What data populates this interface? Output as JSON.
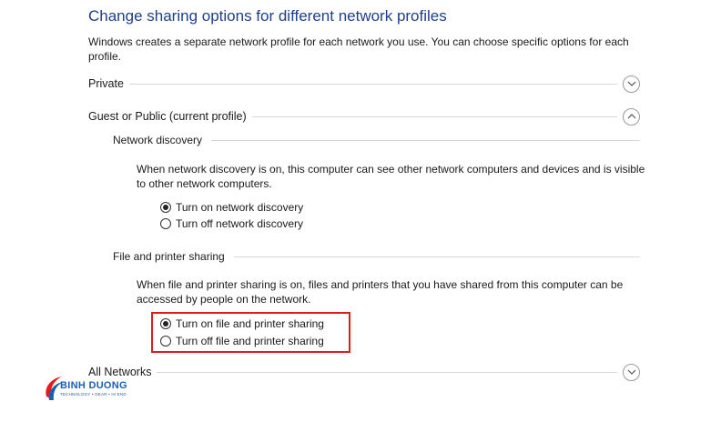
{
  "page": {
    "title": "Change sharing options for different network profiles",
    "description": "Windows creates a separate network profile for each network you use. You can choose specific options for each profile."
  },
  "sections": {
    "private": {
      "label": "Private",
      "expanded": false
    },
    "guest_public": {
      "label": "Guest or Public (current profile)",
      "expanded": true
    },
    "all_networks": {
      "label": "All Networks",
      "expanded": false
    }
  },
  "network_discovery": {
    "heading": "Network discovery",
    "description": "When network discovery is on, this computer can see other network computers and devices and is visible to other network computers.",
    "options": [
      {
        "label": "Turn on network discovery",
        "selected": true
      },
      {
        "label": "Turn off network discovery",
        "selected": false
      }
    ]
  },
  "file_printer_sharing": {
    "heading": "File and printer sharing",
    "description": "When file and printer sharing is on, files and printers that you have shared from this computer can be accessed by people on the network.",
    "options": [
      {
        "label": "Turn on file and printer sharing",
        "selected": true
      },
      {
        "label": "Turn off file and printer sharing",
        "selected": false
      }
    ]
  },
  "watermark": {
    "brand": "BINH DUONG",
    "tagline": "TECHNOLOGY • GEAR • HI END"
  },
  "colors": {
    "title": "#1e3f8a",
    "highlight": "#e21b1b",
    "logo": "#1a5fb4"
  }
}
